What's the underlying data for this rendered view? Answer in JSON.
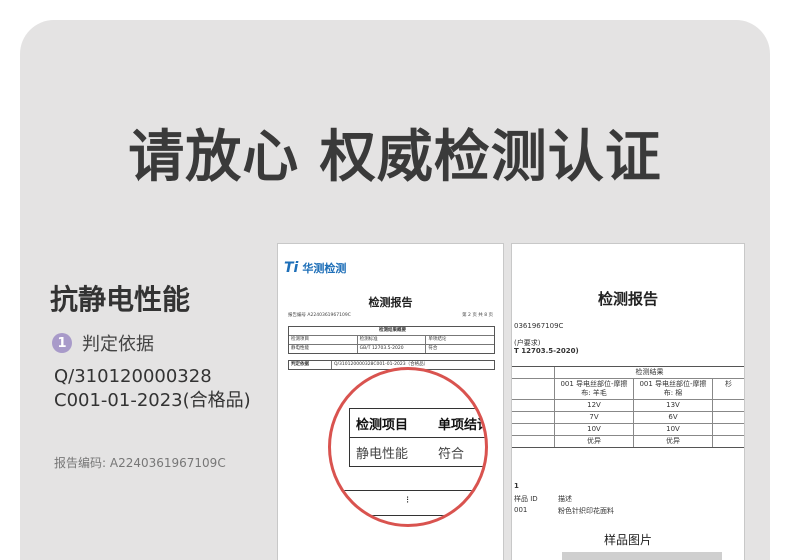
{
  "headline": "请放心 权威检测认证",
  "property_title": "抗静电性能",
  "basis": {
    "badge": "1",
    "label": "判定依据",
    "standard_line1": "Q/310120000328",
    "standard_line2": "C001-01-2023(合格品)"
  },
  "report_number": "报告编码: A2240361967109C",
  "doc1": {
    "logo_mark": "Ti",
    "logo_text": "华测检测",
    "title": "检测报告",
    "report_no_small": "报告编号  A2240361967109C",
    "page_small": "第 2 页 共 8 页",
    "summary_title": "检测结果概要",
    "table_rows": [
      [
        "检测项目",
        "检测标准",
        "单项结论"
      ],
      [
        "静电性能",
        "GB/T 12703.5-2020",
        "符合"
      ]
    ],
    "judge_row": [
      "判定依据",
      "Q/310120000328C001-01-2023（合格品）"
    ]
  },
  "magnifier": {
    "head": [
      "检测项目",
      "单项结论"
    ],
    "row": [
      "静电性能",
      "符合"
    ],
    "dash": "⁝"
  },
  "doc2": {
    "title": "检测报告",
    "frag1": "0361967109C",
    "frag2": "(户要求)",
    "frag3": "T 12703.5-2020)",
    "results_header": "检测结果",
    "table": [
      [
        "",
        "001 导电丝部位-摩擦布: 羊毛",
        "001 导电丝部位-摩擦布: 棉",
        "杉"
      ],
      [
        "",
        "12V",
        "13V",
        ""
      ],
      [
        "",
        "7V",
        "6V",
        ""
      ],
      [
        "",
        "10V",
        "10V",
        ""
      ],
      [
        "",
        "优异",
        "优异",
        ""
      ]
    ],
    "frag4": "1",
    "sample_id_label": "样品 ID",
    "sample_id_value": "描述",
    "sample_code": "001",
    "sample_desc": "粉色针织印花面料",
    "sample_image_title": "样品图片"
  }
}
